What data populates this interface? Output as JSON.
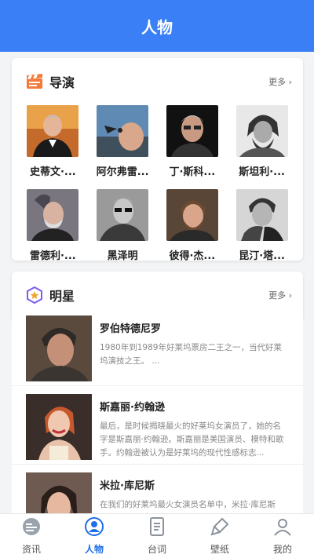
{
  "header": {
    "title": "人物"
  },
  "directors": {
    "title": "导演",
    "more": "更多",
    "items": [
      {
        "name": "史蒂文·..."
      },
      {
        "name": "阿尔弗雷..."
      },
      {
        "name": "丁·斯科..."
      },
      {
        "name": "斯坦利·..."
      },
      {
        "name": "雷德利·..."
      },
      {
        "name": "黑泽明"
      },
      {
        "name": "彼得·杰..."
      },
      {
        "name": "昆汀·塔..."
      }
    ]
  },
  "stars": {
    "title": "明星",
    "more": "更多",
    "items": [
      {
        "name": "罗伯特德尼罗",
        "desc": "1980年到1989年好莱坞票房二王之一，当代好莱坞演技之王。 ..."
      },
      {
        "name": "斯嘉丽·约翰逊",
        "desc": "最后，是时候揭晓最火的好莱坞女演员了，她的名字是斯嘉丽·约翰逊。斯嘉丽是美国演员、模特和歌手。约翰逊被认为是好莱坞的现代性感标志..."
      },
      {
        "name": "米拉·库尼斯",
        "desc": "在我们的好莱坞最火女演员名单中，米拉·库尼斯"
      }
    ]
  },
  "tabs": [
    {
      "label": "资讯"
    },
    {
      "label": "人物"
    },
    {
      "label": "台词"
    },
    {
      "label": "壁纸"
    },
    {
      "label": "我的"
    }
  ]
}
